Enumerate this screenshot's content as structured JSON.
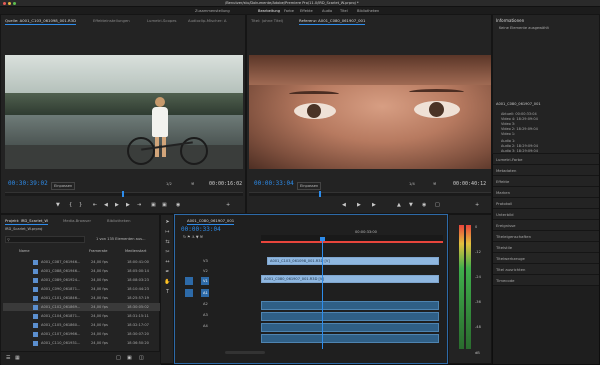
{
  "titlebar": {
    "title": "/Benutzer/stu/Dokumente/Adobe/Premiere Pro/11.0/IRD_Scarlet_W.prproj *"
  },
  "workspaces": [
    "Zusammenstellung",
    "Bearbeitung",
    "Farbe",
    "Effekte",
    "Audio",
    "Titel",
    "Bibliotheken"
  ],
  "source": {
    "tabs": [
      "Quelle: A001_C103_061098_001.R3D",
      "Effekteinstellungen",
      "Lumetri-Scopes",
      "Audioclip-Mischer: A"
    ],
    "timecode": "00:30:39:02",
    "fit": "Einpassen",
    "scale": "1/2",
    "duration": "00:00:16:02"
  },
  "program": {
    "tabs": [
      "Titel: (ohne Titel)",
      "Referenz: A001_C080_061907_001"
    ],
    "timecode": "00:00:33:04",
    "fit": "Einpassen",
    "scale": "1/4",
    "duration": "00:00:40:12"
  },
  "info": {
    "title": "Informationen",
    "subtitle": "Keine Elemente ausgewählt",
    "clipname": "A001_C080_061907_001",
    "rows": [
      "Aktuell: 00:00:33:04",
      "Video 4: 18:29:09:04",
      "Video 3:",
      "Video 2: 18:29:09:04",
      "Video 1:",
      "Audio 1:",
      "Audio 2: 18:29:09:04",
      "Audio 3: 18:29:09:04",
      "Audio 4: 18:29:09:04",
      "Audio 5: 18:29:09:04"
    ]
  },
  "side_panels": [
    "Lumetri-Farbe",
    "Metadaten",
    "Effekte",
    "Marken",
    "Protokoll",
    "Unterbild",
    "Ereignisse",
    "Titeleigenschaften",
    "Titelstile",
    "Titelwerkzeuge",
    "Titel ausrichten",
    "Timecode"
  ],
  "project": {
    "tabs": [
      "Projekt: IRD_Scarlet_W",
      "Media-Browser",
      "Bibliotheken"
    ],
    "file": "IRD_Scarlet_W.prproj",
    "count": "1 von 135 Elementen aus...",
    "columns": [
      "Name",
      "Framerate",
      "Medienstart"
    ],
    "rows": [
      {
        "name": "A001_C087_061946...",
        "fps": "24,00 fps",
        "start": "18:00:41:00"
      },
      {
        "name": "A001_C088_061946...",
        "fps": "24,00 fps",
        "start": "18:05:00:14"
      },
      {
        "name": "A001_C089_061924...",
        "fps": "24,00 fps",
        "start": "18:08:03:23"
      },
      {
        "name": "A001_C090_061871...",
        "fps": "24,00 fps",
        "start": "18:10:44:23"
      },
      {
        "name": "A001_C101_061846...",
        "fps": "24,00 fps",
        "start": "18:25:57:19"
      },
      {
        "name": "A001_C102_061869...",
        "fps": "24,00 fps",
        "start": "18:30:05:02"
      },
      {
        "name": "A001_C104_061871...",
        "fps": "24,00 fps",
        "start": "18:31:15:11"
      },
      {
        "name": "A001_C105_061860...",
        "fps": "24,00 fps",
        "start": "18:32:17:07"
      },
      {
        "name": "A001_C107_061966...",
        "fps": "24,00 fps",
        "start": "18:30:07:20"
      },
      {
        "name": "A001_C110_061931...",
        "fps": "24,00 fps",
        "start": "18:36:50:20"
      }
    ]
  },
  "timeline": {
    "tab": "A001_C080_061907_001",
    "timecode": "00:00:33:04",
    "ruler_mark": "00:00:33:00",
    "tracks": [
      "V3",
      "V2",
      "V1",
      "A1",
      "A2",
      "A3",
      "A4"
    ],
    "clip_v2": "A001_C103_061098_001.R3D [V]",
    "clip_v1": "A001_C080_061907_001.R3D [V]"
  },
  "meter": {
    "labels": [
      "0",
      "-12",
      "-24",
      "-36",
      "-48",
      "dB"
    ]
  },
  "colors": {
    "accent": "#2d8ceb",
    "clip": "#8fb7e0",
    "audio": "#2f5f86",
    "playhead_red": "#e8453c"
  }
}
